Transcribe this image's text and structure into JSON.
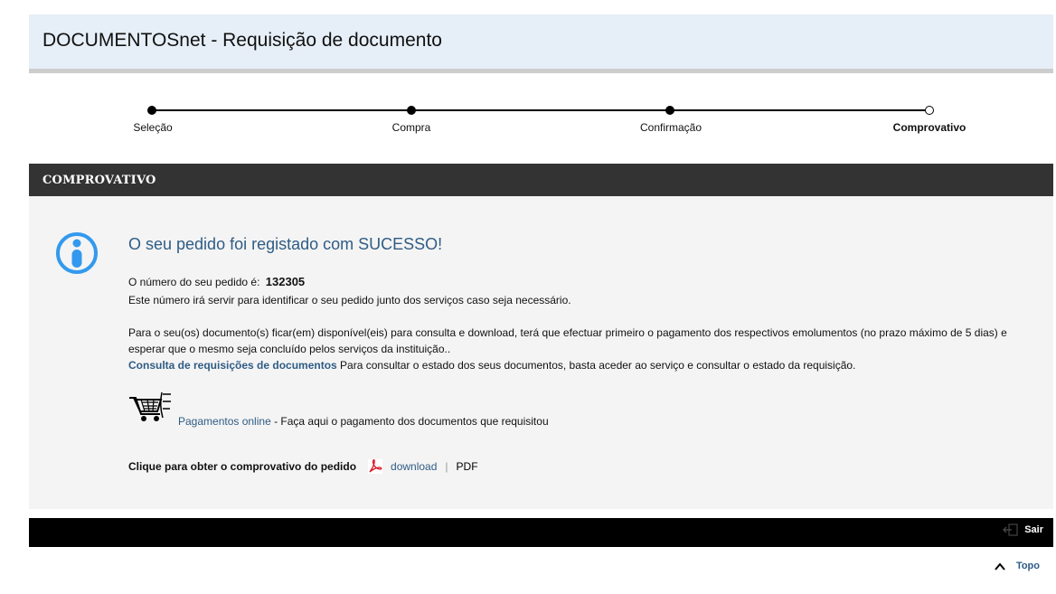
{
  "header": {
    "title": "DOCUMENTOSnet - Requisição de documento"
  },
  "steps": [
    {
      "label": "Seleção"
    },
    {
      "label": "Compra"
    },
    {
      "label": "Confirmação"
    },
    {
      "label": "Comprovativo"
    }
  ],
  "section": {
    "title": "COMPROVATIVO"
  },
  "content": {
    "success_message": "O seu pedido foi registado com SUCESSO!",
    "order_label": "O número do seu pedido é:",
    "order_number": "132305",
    "order_note": "Este número irá servir para identificar o seu pedido junto dos serviços caso seja necessário.",
    "payment_note_1": "Para o seu(os) documento(s) ficar(em) disponível(eis) para consulta e download, terá que efectuar primeiro o pagamento dos respectivos emolumentos (no prazo máximo de 5 dias) e",
    "payment_note_2": "esperar que o mesmo seja concluído pelos serviços da instituição..",
    "consulta_link": "Consulta de requisições de documentos",
    "consulta_text": " Para consultar o estado dos seus documentos, basta aceder ao serviço e consultar o estado da requisição.",
    "pagamentos_link": "Pagamentos online",
    "pagamentos_text": " - Faça aqui o pagamento dos documentos que requisitou",
    "comprovativo_label": "Clique para obter o comprovativo do pedido",
    "download_link": "download",
    "separator": "|",
    "format": "PDF"
  },
  "footer": {
    "exit_label": "Sair",
    "top_label": "Topo"
  },
  "colors": {
    "header_bg": "#e6eef7",
    "section_bg": "#333333",
    "accent": "#2f5c85",
    "info_icon": "#3399ee"
  },
  "icons": [
    "info-icon",
    "cart-icon",
    "pdf-icon",
    "exit-icon",
    "chevron-up-icon"
  ]
}
